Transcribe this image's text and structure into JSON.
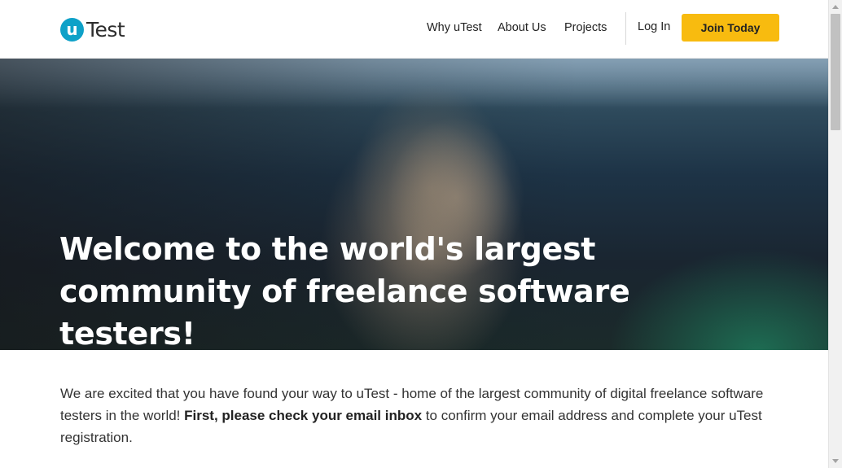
{
  "header": {
    "logo": {
      "badge": "u",
      "text": "Test"
    },
    "nav": {
      "why": "Why uTest",
      "about": "About Us",
      "projects": "Projects",
      "login": "Log In",
      "join": "Join Today"
    }
  },
  "hero": {
    "title": "Welcome to the world's largest community of freelance software testers!"
  },
  "intro": {
    "part1": "We are excited that you have found your way to uTest - home of the largest community of digital freelance software testers in the world! ",
    "bold": "First, please check your email inbox",
    "part2": " to confirm your email address and complete your uTest registration."
  },
  "colors": {
    "accent": "#f8bb0f",
    "brand": "#0ea1c8"
  }
}
